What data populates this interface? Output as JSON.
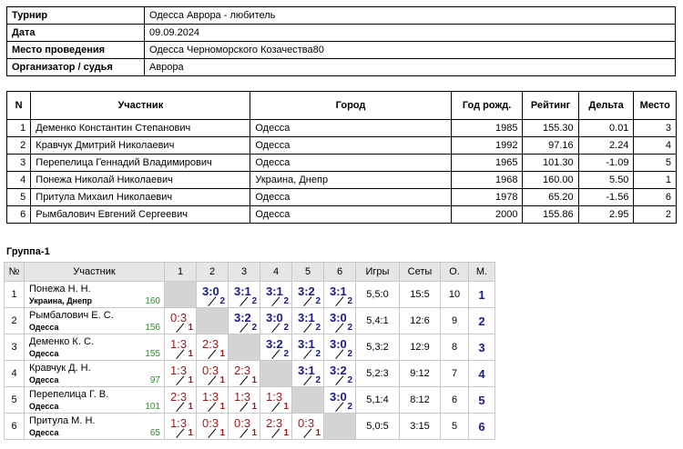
{
  "info": [
    {
      "label": "Турнир",
      "value": "Одесса Аврора  - любитель"
    },
    {
      "label": "Дата",
      "value": "09.09.2024"
    },
    {
      "label": "Место проведения",
      "value": "Одесса  Черноморского Козачества80"
    },
    {
      "label": "Организатор / судья",
      "value": "Аврора"
    }
  ],
  "participants": {
    "headers": [
      "N",
      "Участник",
      "Город",
      "Год рожд.",
      "Рейтинг",
      "Дельта",
      "Место"
    ],
    "rows": [
      [
        "1",
        "Деменко Константин Степанович",
        "Одесса",
        "1985",
        "155.30",
        "0.01",
        "3"
      ],
      [
        "2",
        "Кравчук Дмитрий Николаевич",
        "Одесса",
        "1992",
        "97.16",
        "2.24",
        "4"
      ],
      [
        "3",
        "Перепелица Геннадий Владимирович",
        "Одесса",
        "1965",
        "101.30",
        "-1.09",
        "5"
      ],
      [
        "4",
        "Понежа Николай Николаевич",
        "Украина, Днепр",
        "1968",
        "160.00",
        "5.50",
        "1"
      ],
      [
        "5",
        "Притула Михаил Николаевич",
        "Одесса",
        "1978",
        "65.20",
        "-1.56",
        "6"
      ],
      [
        "6",
        "Рымбалович Евгений Сергеевич",
        "Одесса",
        "2000",
        "155.86",
        "2.95",
        "2"
      ]
    ]
  },
  "group": {
    "title": "Группа-1",
    "headers": [
      "№",
      "Участник",
      "1",
      "2",
      "3",
      "4",
      "5",
      "6",
      "Игры",
      "Сеты",
      "О.",
      "М."
    ],
    "rows": [
      {
        "num": "1",
        "name": "Понежа Н. Н.",
        "city": "Украина, Днепр",
        "rating": "160",
        "cells": [
          null,
          {
            "s": "3:0",
            "p": "2",
            "w": true
          },
          {
            "s": "3:1",
            "p": "2",
            "w": true
          },
          {
            "s": "3:1",
            "p": "2",
            "w": true
          },
          {
            "s": "3:2",
            "p": "2",
            "w": true
          },
          {
            "s": "3:1",
            "p": "2",
            "w": true
          }
        ],
        "games": "5,5:0",
        "sets": "15:5",
        "pts": "10",
        "place": "1"
      },
      {
        "num": "2",
        "name": "Рымбалович Е. С.",
        "city": "Одесса",
        "rating": "156",
        "cells": [
          {
            "s": "0:3",
            "p": "1",
            "w": false
          },
          null,
          {
            "s": "3:2",
            "p": "2",
            "w": true
          },
          {
            "s": "3:0",
            "p": "2",
            "w": true
          },
          {
            "s": "3:1",
            "p": "2",
            "w": true
          },
          {
            "s": "3:0",
            "p": "2",
            "w": true
          }
        ],
        "games": "5,4:1",
        "sets": "12:6",
        "pts": "9",
        "place": "2"
      },
      {
        "num": "3",
        "name": "Деменко К. С.",
        "city": "Одесса",
        "rating": "155",
        "cells": [
          {
            "s": "1:3",
            "p": "1",
            "w": false
          },
          {
            "s": "2:3",
            "p": "1",
            "w": false
          },
          null,
          {
            "s": "3:2",
            "p": "2",
            "w": true
          },
          {
            "s": "3:1",
            "p": "2",
            "w": true
          },
          {
            "s": "3:0",
            "p": "2",
            "w": true
          }
        ],
        "games": "5,3:2",
        "sets": "12:9",
        "pts": "8",
        "place": "3"
      },
      {
        "num": "4",
        "name": "Кравчук Д. Н.",
        "city": "Одесса",
        "rating": "97",
        "cells": [
          {
            "s": "1:3",
            "p": "1",
            "w": false
          },
          {
            "s": "0:3",
            "p": "1",
            "w": false
          },
          {
            "s": "2:3",
            "p": "1",
            "w": false
          },
          null,
          {
            "s": "3:1",
            "p": "2",
            "w": true
          },
          {
            "s": "3:2",
            "p": "2",
            "w": true
          }
        ],
        "games": "5,2:3",
        "sets": "9:12",
        "pts": "7",
        "place": "4"
      },
      {
        "num": "5",
        "name": "Перепелица Г. В.",
        "city": "Одесса",
        "rating": "101",
        "cells": [
          {
            "s": "2:3",
            "p": "1",
            "w": false
          },
          {
            "s": "1:3",
            "p": "1",
            "w": false
          },
          {
            "s": "1:3",
            "p": "1",
            "w": false
          },
          {
            "s": "1:3",
            "p": "1",
            "w": false
          },
          null,
          {
            "s": "3:0",
            "p": "2",
            "w": true
          }
        ],
        "games": "5,1:4",
        "sets": "8:12",
        "pts": "6",
        "place": "5"
      },
      {
        "num": "6",
        "name": "Притула М. Н.",
        "city": "Одесса",
        "rating": "65",
        "cells": [
          {
            "s": "1:3",
            "p": "1",
            "w": false
          },
          {
            "s": "0:3",
            "p": "1",
            "w": false
          },
          {
            "s": "0:3",
            "p": "1",
            "w": false
          },
          {
            "s": "2:3",
            "p": "1",
            "w": false
          },
          {
            "s": "0:3",
            "p": "1",
            "w": false
          },
          null
        ],
        "games": "5,0:5",
        "sets": "3:15",
        "pts": "5",
        "place": "6"
      }
    ]
  },
  "colors": {
    "win": "#1a1a8c",
    "loss": "#9a1a1a",
    "rating": "#2a8c2a",
    "self_cell": "#d4d4d4"
  }
}
